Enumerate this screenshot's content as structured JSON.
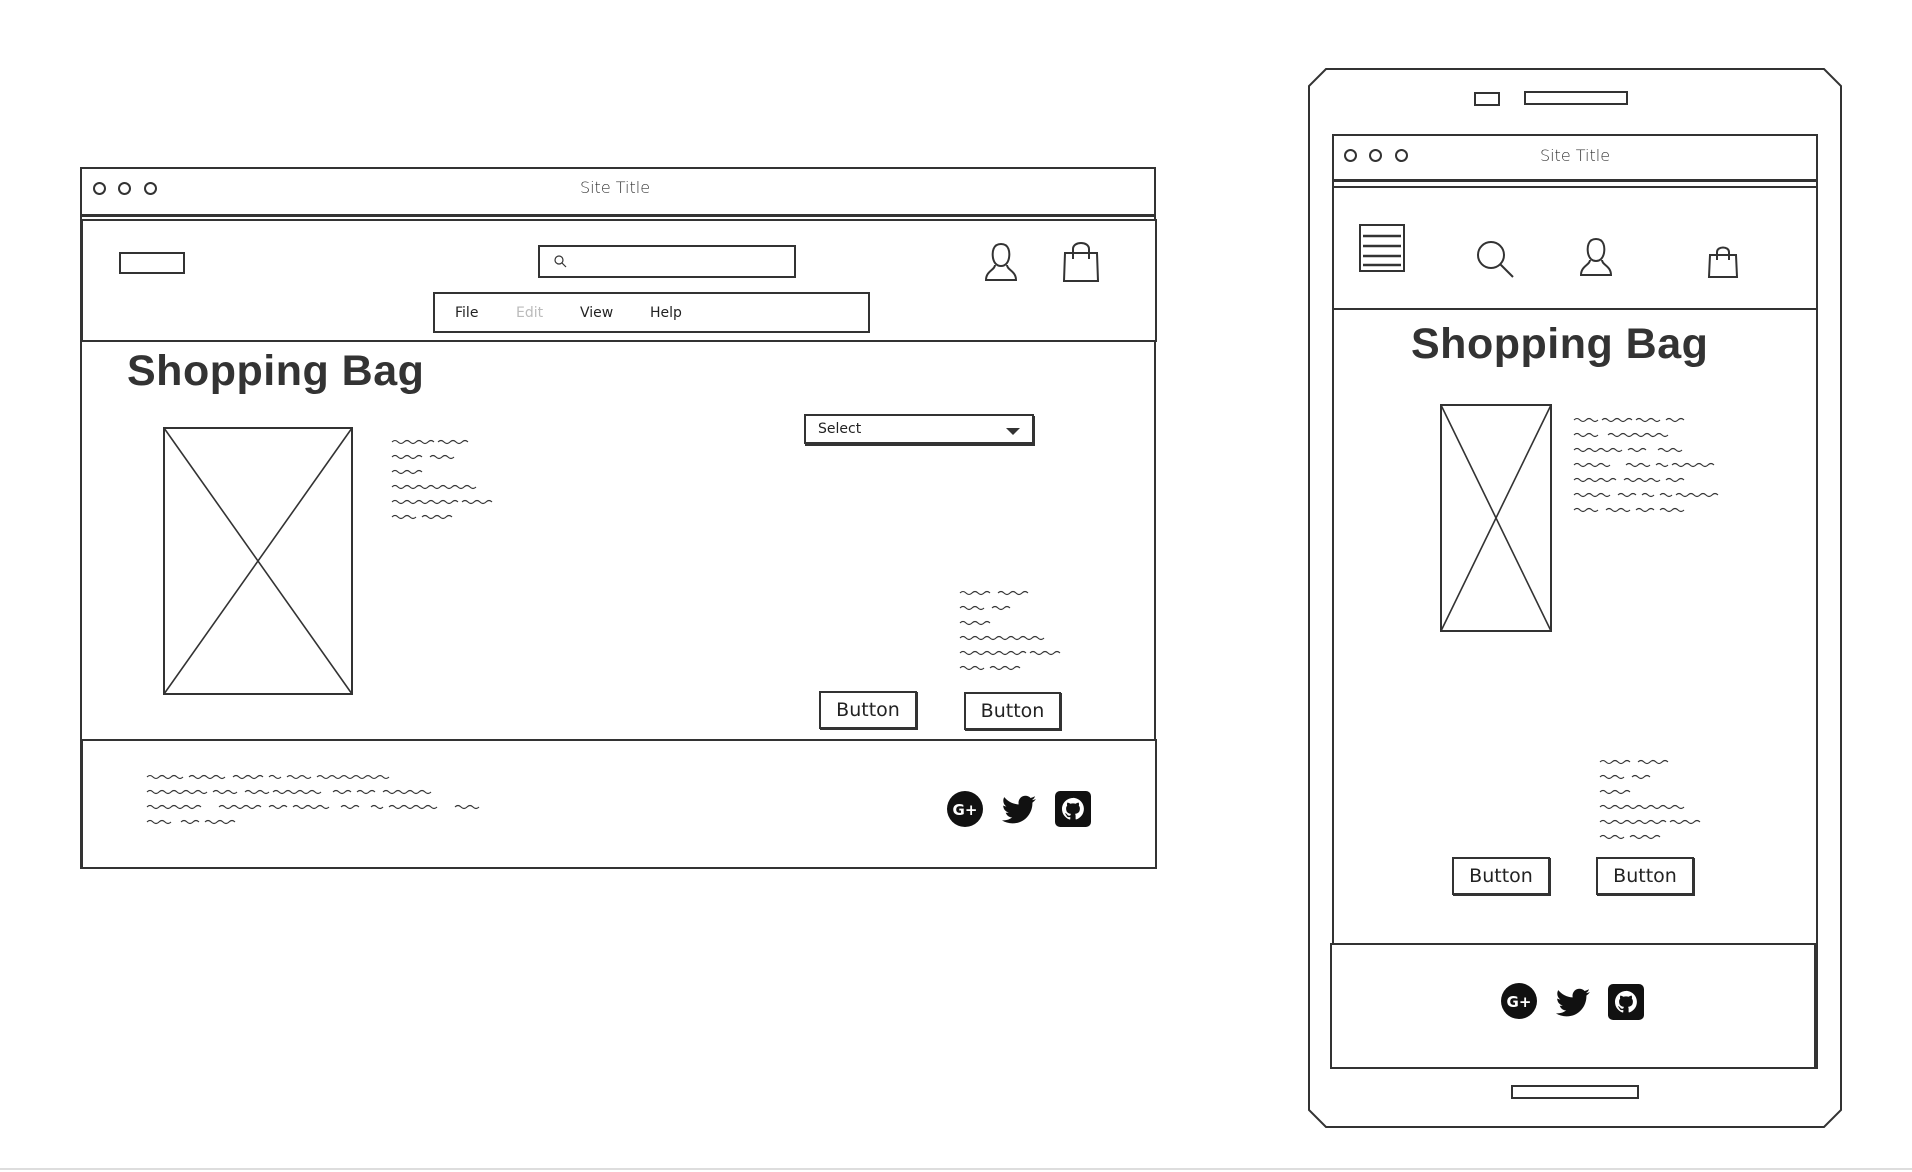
{
  "desktop": {
    "window_title": "Site Title",
    "search": {
      "placeholder": ""
    },
    "menu": [
      {
        "label": "File",
        "disabled": false
      },
      {
        "label": "Edit",
        "disabled": true
      },
      {
        "label": "View",
        "disabled": false
      },
      {
        "label": "Help",
        "disabled": false
      }
    ],
    "page_title": "Shopping Bag",
    "select": {
      "value": "Select"
    },
    "buttons": [
      "Button",
      "Button"
    ],
    "social_icons": [
      "google-plus-icon",
      "twitter-icon",
      "github-icon"
    ]
  },
  "mobile": {
    "window_title": "Site Title",
    "page_title": "Shopping Bag",
    "buttons": [
      "Button",
      "Button"
    ],
    "social_icons": [
      "google-plus-icon",
      "twitter-icon",
      "github-icon"
    ]
  },
  "colors": {
    "stroke": "#333333",
    "background": "#ffffff",
    "disabled_text": "#bbbbbb"
  }
}
